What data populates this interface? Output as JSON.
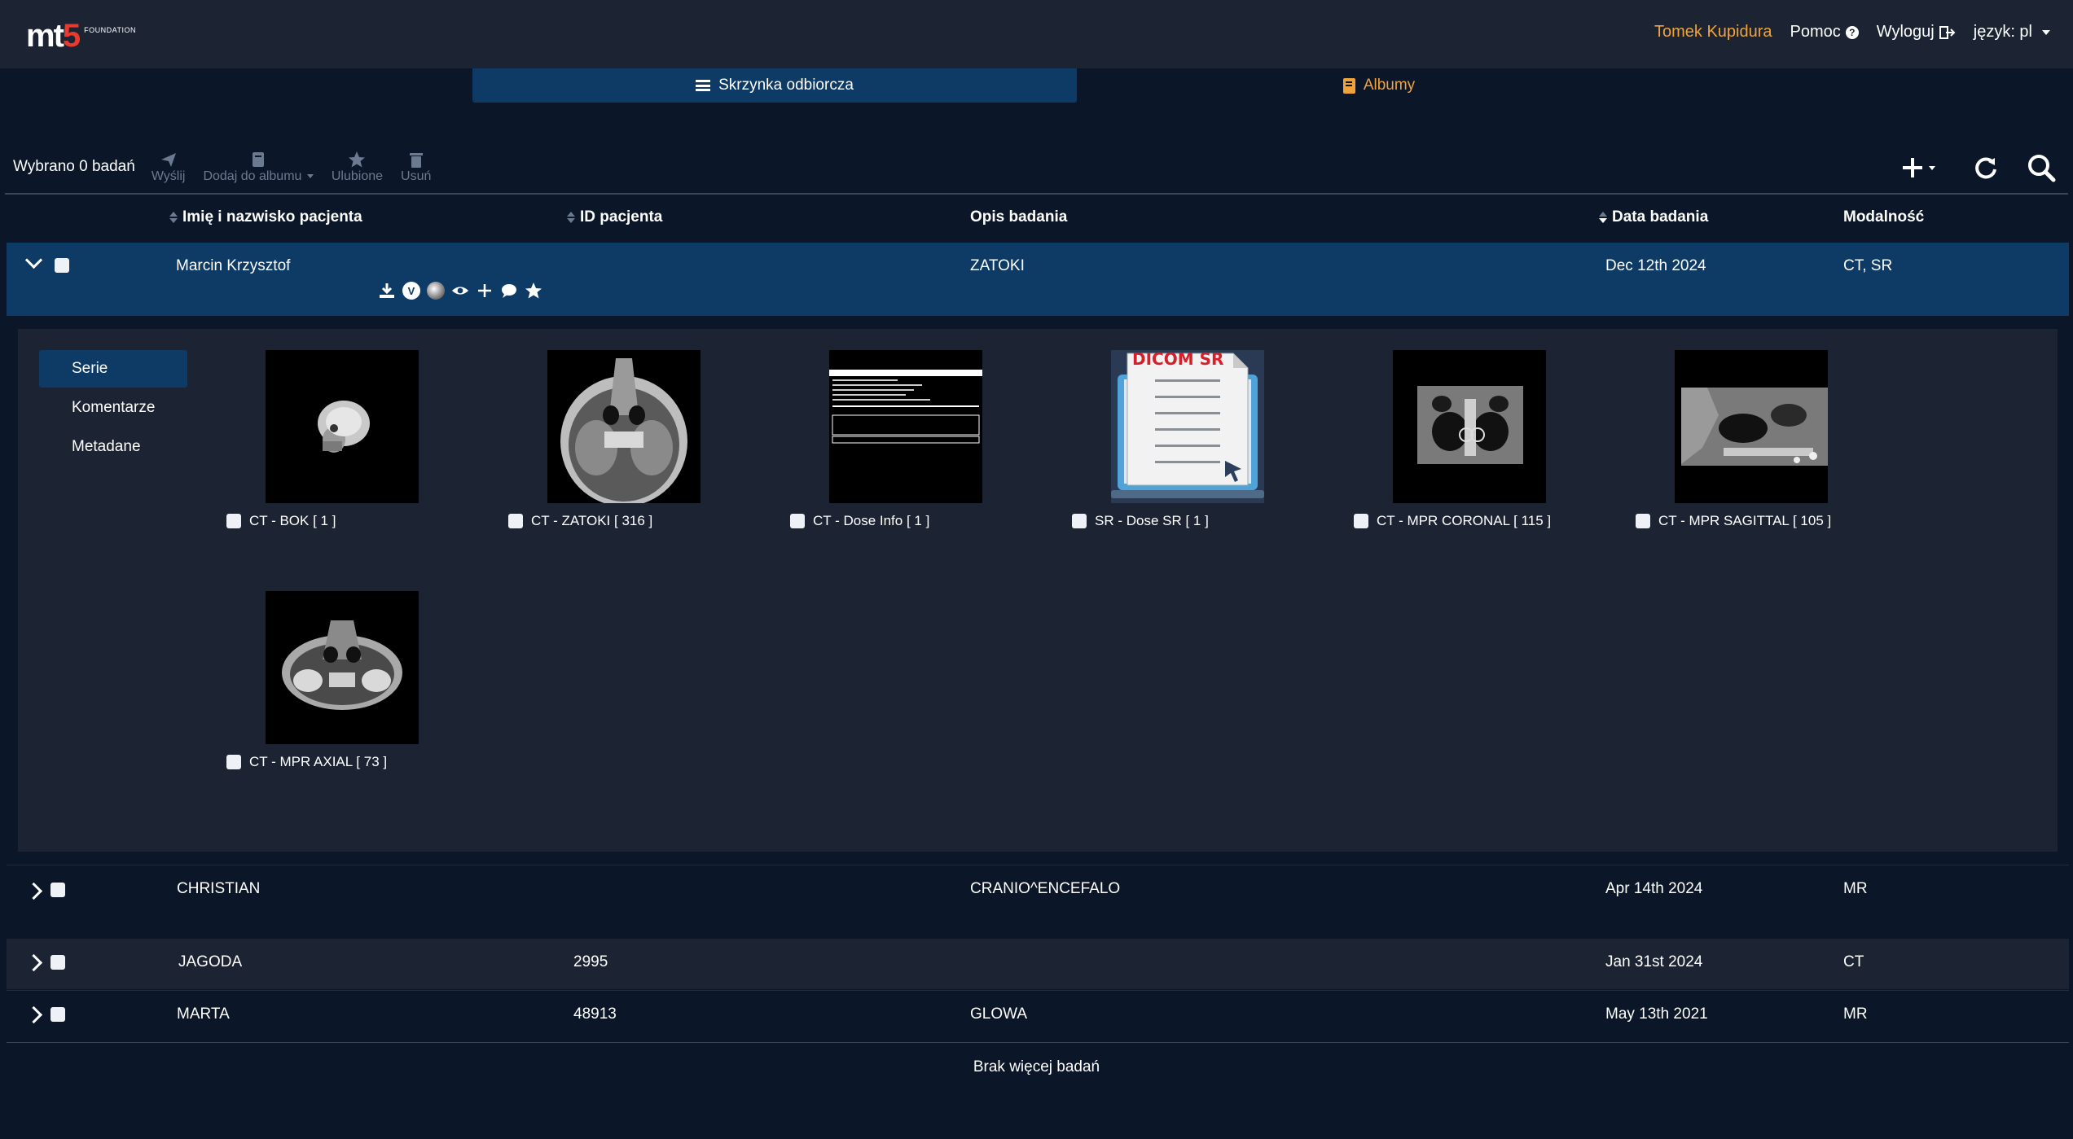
{
  "brand": {
    "logo_text_a": "mt",
    "logo_text_b": "5",
    "logo_sub": "FOUNDATION"
  },
  "nav": {
    "user": "Tomek Kupidura",
    "help": "Pomoc",
    "logout": "Wyloguj",
    "language": "język: pl"
  },
  "tabs": {
    "inbox": "Skrzynka odbiorcza",
    "albums": "Albumy"
  },
  "toolbar": {
    "selected": "Wybrano 0 badań",
    "send": "Wyślij",
    "add_album": "Dodaj do albumu",
    "favorites": "Ulubione",
    "delete": "Usuń"
  },
  "table": {
    "headers": {
      "name": "Imię i nazwisko pacjenta",
      "patient_id": "ID pacjenta",
      "description": "Opis badania",
      "date": "Data badania",
      "modality": "Modalność"
    },
    "rows": [
      {
        "name": "Marcin Krzysztof",
        "patient_id": "",
        "description": "ZATOKI",
        "date": "Dec 12th 2024",
        "modality": "CT, SR"
      },
      {
        "name": "CHRISTIAN",
        "patient_id": "",
        "description": "CRANIO^ENCEFALO",
        "date": "Apr 14th 2024",
        "modality": "MR"
      },
      {
        "name": "JAGODA",
        "patient_id": "2995",
        "description": "",
        "date": "Jan 31st 2024",
        "modality": "CT"
      },
      {
        "name": "MARTA",
        "patient_id": "48913",
        "description": "GLOWA",
        "date": "May 13th 2021",
        "modality": "MR"
      }
    ]
  },
  "detail": {
    "side": [
      "Serie",
      "Komentarze",
      "Metadane"
    ],
    "series": [
      {
        "label": "CT - BOK [ 1 ]",
        "icon": "skull-thumbnail"
      },
      {
        "label": "CT - ZATOKI [ 316 ]",
        "icon": "axial-ct-thumbnail"
      },
      {
        "label": "CT - Dose Info [ 1 ]",
        "icon": "dose-table-thumbnail"
      },
      {
        "label": "SR - Dose SR [ 1 ]",
        "icon": "dicom-sr-thumbnail",
        "thumb_text": "DICOM SR"
      },
      {
        "label": "CT - MPR CORONAL [ 115 ]",
        "icon": "coronal-ct-thumbnail"
      },
      {
        "label": "CT - MPR SAGITTAL [ 105 ]",
        "icon": "sagittal-ct-thumbnail"
      },
      {
        "label": "CT - MPR AXIAL [ 73 ]",
        "icon": "axial-mpr-thumbnail"
      }
    ]
  },
  "footer": "Brak więcej badań",
  "colors": {
    "accent": "#f0a33b",
    "primary": "#0e3a66",
    "background": "#0b1628",
    "panel": "#1c2433"
  }
}
